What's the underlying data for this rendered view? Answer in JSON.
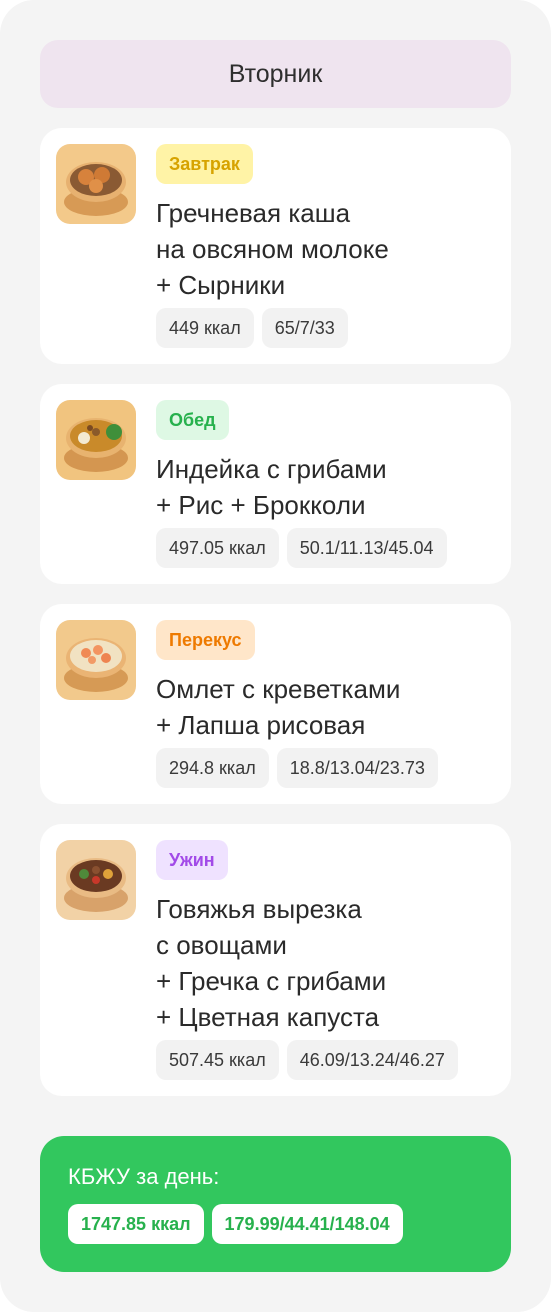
{
  "day": {
    "title": "Вторник"
  },
  "meals": [
    {
      "tag": "Завтрак",
      "title": "Гречневая каша\nна овсяном молоке\n+ Сырники",
      "kcal": "449 ккал",
      "macros": "65/7/33",
      "image_icon": "buckwheat-syrniki-dish-icon"
    },
    {
      "tag": "Обед",
      "title": "Индейка с грибами\n+ Рис + Брокколи",
      "kcal": "497.05 ккал",
      "macros": "50.1/11.13/45.04",
      "image_icon": "turkey-rice-broccoli-dish-icon"
    },
    {
      "tag": "Перекус",
      "title": "Омлет с креветками\n+ Лапша рисовая",
      "kcal": "294.8 ккал",
      "macros": "18.8/13.04/23.73",
      "image_icon": "shrimp-omelette-noodles-dish-icon"
    },
    {
      "tag": "Ужин",
      "title": "Говяжья вырезка\nс овощами\n+ Гречка с грибами\n+ Цветная капуста",
      "kcal": "507.45 ккал",
      "macros": "46.09/13.24/46.27",
      "image_icon": "beef-vegetables-dish-icon"
    }
  ],
  "summary": {
    "title": "КБЖУ за день:",
    "kcal": "1747.85 ккал",
    "macros": "179.99/44.41/148.04"
  },
  "colors": {
    "breakfast_tag": "#d7a300",
    "lunch_tag": "#27b14d",
    "snack_tag": "#ee7a00",
    "dinner_tag": "#a24ae8",
    "summary_bg": "#32c75e",
    "day_header_bg": "#efe4ef"
  }
}
